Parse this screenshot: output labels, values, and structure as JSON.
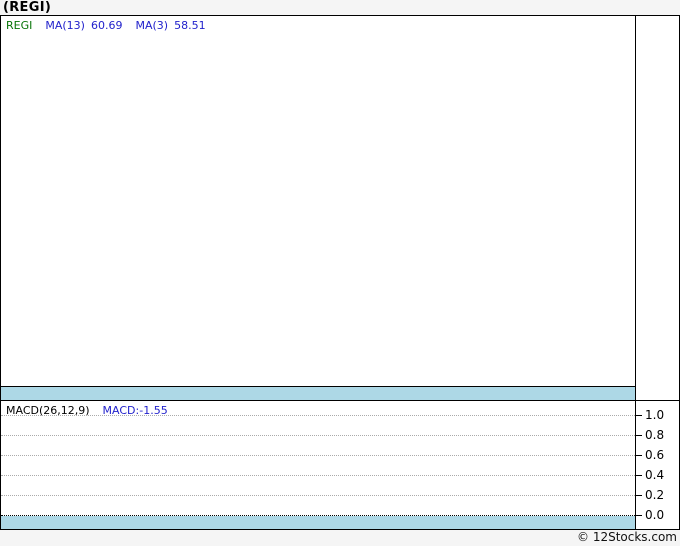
{
  "page": {
    "title": "(REGI)",
    "copyright": "© 12Stocks.com"
  },
  "main_chart": {
    "legend": {
      "symbol": "REGI",
      "ma1_label": "MA(13)",
      "ma1_value": "60.69",
      "ma2_label": "MA(3)",
      "ma2_value": "58.51"
    }
  },
  "macd_panel": {
    "legend_label": "MACD(26,12,9)",
    "legend_value": "MACD:-1.55",
    "axis_ticks": [
      "1.0",
      "0.8",
      "0.6",
      "0.4",
      "0.2",
      "0.0"
    ]
  },
  "colors": {
    "symbol_green": "#077407",
    "legend_blue": "#2222cc",
    "strip_blue": "#add8e6",
    "grid_gray": "#aaaaaa",
    "page_bg": "#f5f5f5"
  },
  "chart_data": [
    {
      "type": "line",
      "title": "(REGI)",
      "series": [
        {
          "name": "REGI",
          "values": []
        },
        {
          "name": "MA(13)",
          "last_value": 60.69,
          "values": []
        },
        {
          "name": "MA(3)",
          "last_value": 58.51,
          "values": []
        }
      ],
      "legend_position": "top-left",
      "grid": false,
      "note": "price panel rendered empty — no visible data points"
    },
    {
      "type": "line",
      "title": "MACD(26,12,9)",
      "series": [
        {
          "name": "MACD",
          "last_value": -1.55,
          "values": []
        }
      ],
      "ylim": [
        0.0,
        1.0
      ],
      "yticks": [
        1.0,
        0.8,
        0.6,
        0.4,
        0.2,
        0.0
      ],
      "legend_position": "top-left",
      "grid": true,
      "note": "MACD panel rendered empty — no visible data points"
    }
  ]
}
